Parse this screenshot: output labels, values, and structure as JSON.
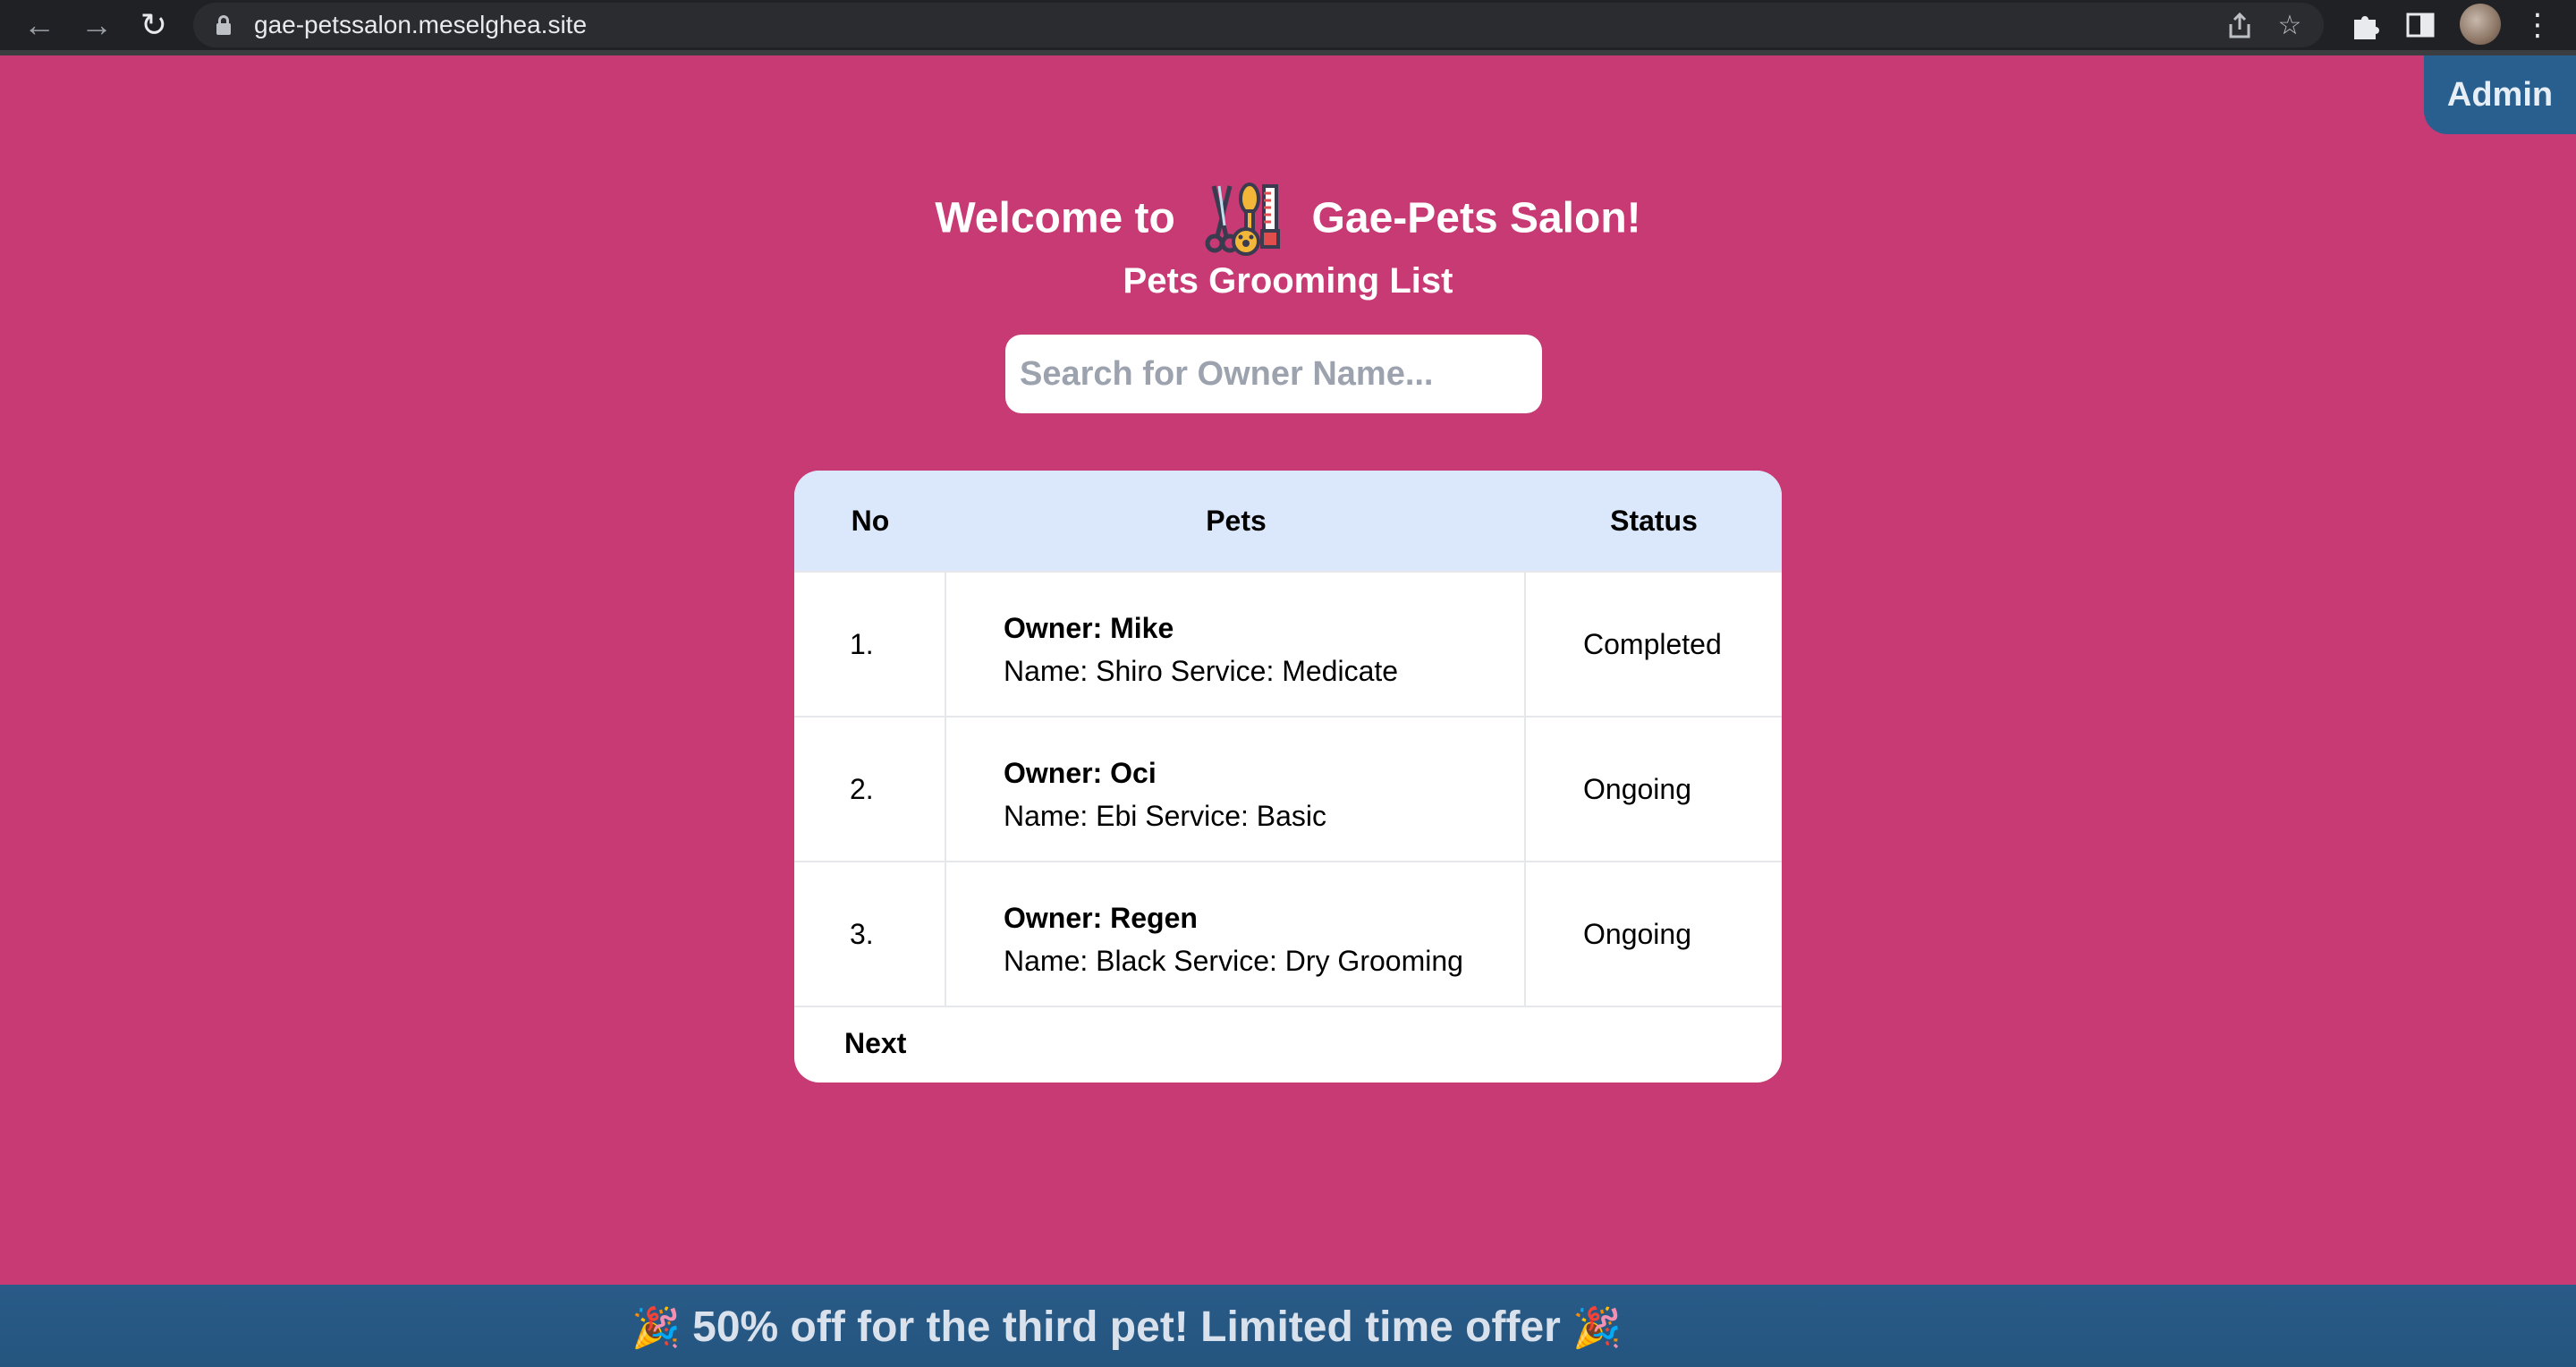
{
  "browser": {
    "url": "gae-petssalon.meselghea.site"
  },
  "admin": {
    "label": "Admin"
  },
  "header": {
    "welcome_prefix": "Welcome to",
    "salon_name": "Gae-Pets Salon!",
    "subtitle": "Pets Grooming List",
    "logo_icon": "grooming-tools-icon"
  },
  "search": {
    "placeholder": "Search for Owner Name...",
    "value": ""
  },
  "table": {
    "headers": {
      "no": "No",
      "pets": "Pets",
      "status": "Status"
    },
    "rows": [
      {
        "no": "1.",
        "owner": "Owner: Mike",
        "detail": "Name: Shiro Service: Medicate",
        "status": "Completed"
      },
      {
        "no": "2.",
        "owner": "Owner: Oci",
        "detail": "Name: Ebi Service: Basic",
        "status": "Ongoing"
      },
      {
        "no": "3.",
        "owner": "Owner: Regen",
        "detail": "Name: Black Service: Dry Grooming",
        "status": "Ongoing"
      }
    ],
    "next_label": "Next"
  },
  "banner": {
    "text": "50% off for the third pet! Limited time offer",
    "emoji": "🎉"
  },
  "colors": {
    "page_bg": "#c83a74",
    "accent_blue": "#295f8f",
    "table_header_bg": "#dbe8fb"
  }
}
